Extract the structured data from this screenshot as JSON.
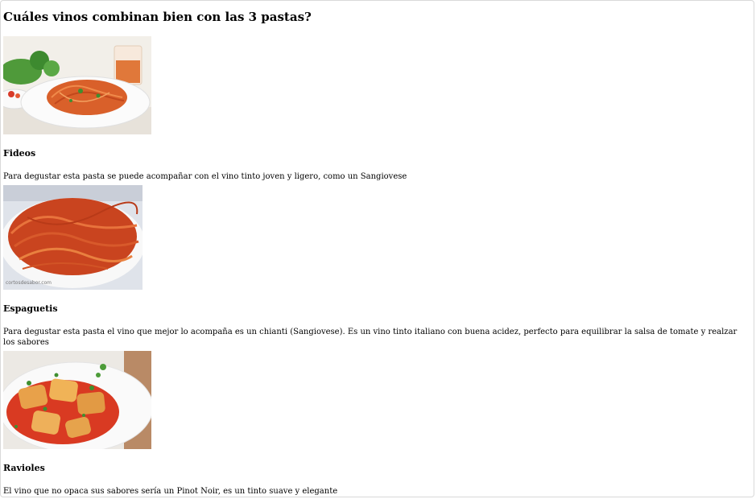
{
  "page": {
    "title": "Cuáles vinos combinan bien con las 3 pastas?"
  },
  "pastas": [
    {
      "name": "Fideos",
      "description": "Para degustar esta pasta se puede acompañar con el vino tinto joven y ligero, como un Sangiovese",
      "image_icon": "spaghetti-plate-photo"
    },
    {
      "name": "Espaguetis",
      "description": "Para degustar esta pasta el vino que mejor lo acompaña es un chianti (Sangiovese). Es un vino tinto italiano con buena acidez, perfecto para equilibrar la salsa de tomate y realzar los sabores",
      "image_icon": "spaghetti-closeup-photo",
      "image_watermark": "cortosdesabor.com"
    },
    {
      "name": "Ravioles",
      "description": "El vino que no opaca sus sabores sería un Pinot Noir, es un tinto suave y elegante",
      "image_icon": "ravioli-plate-photo"
    }
  ],
  "colors": {
    "frame_border": "#d9d9d9",
    "plate": "#f5f5f5",
    "pasta": "#d9602a",
    "herb": "#3f8f2f"
  }
}
